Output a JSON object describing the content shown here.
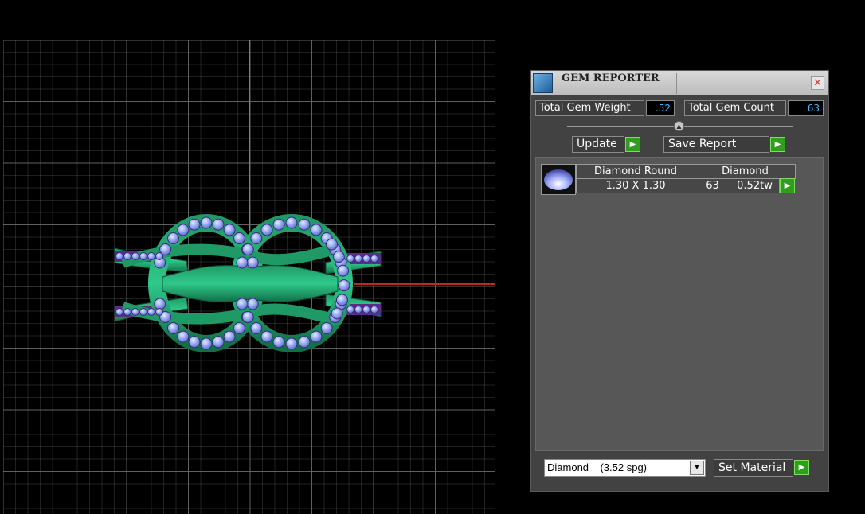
{
  "viewport": {
    "grid_color": "#6a6a6a",
    "y_axis_color": "#3aa6c8",
    "x_axis_color": "#c0281e",
    "model": "knot-ring"
  },
  "gem_reporter": {
    "title": "GEM REPORTER",
    "close_icon": "close-icon",
    "total_gem_weight_label": "Total Gem Weight",
    "total_gem_weight_value": ".52",
    "total_gem_count_label": "Total Gem Count",
    "total_gem_count_value": "63",
    "update_label": "Update",
    "save_report_label": "Save Report",
    "gems": [
      {
        "shape": "Diamond Round",
        "material": "Diamond",
        "size": "1.30 X 1.30",
        "count": "63",
        "weight": "0.52tw",
        "icon": "gem-thumbnail-icon"
      }
    ],
    "material_select_value": "Diamond    (3.52 spg)",
    "set_material_label": "Set Material",
    "accent_green": "#2f9e1c",
    "value_color": "#3fb6ff"
  }
}
